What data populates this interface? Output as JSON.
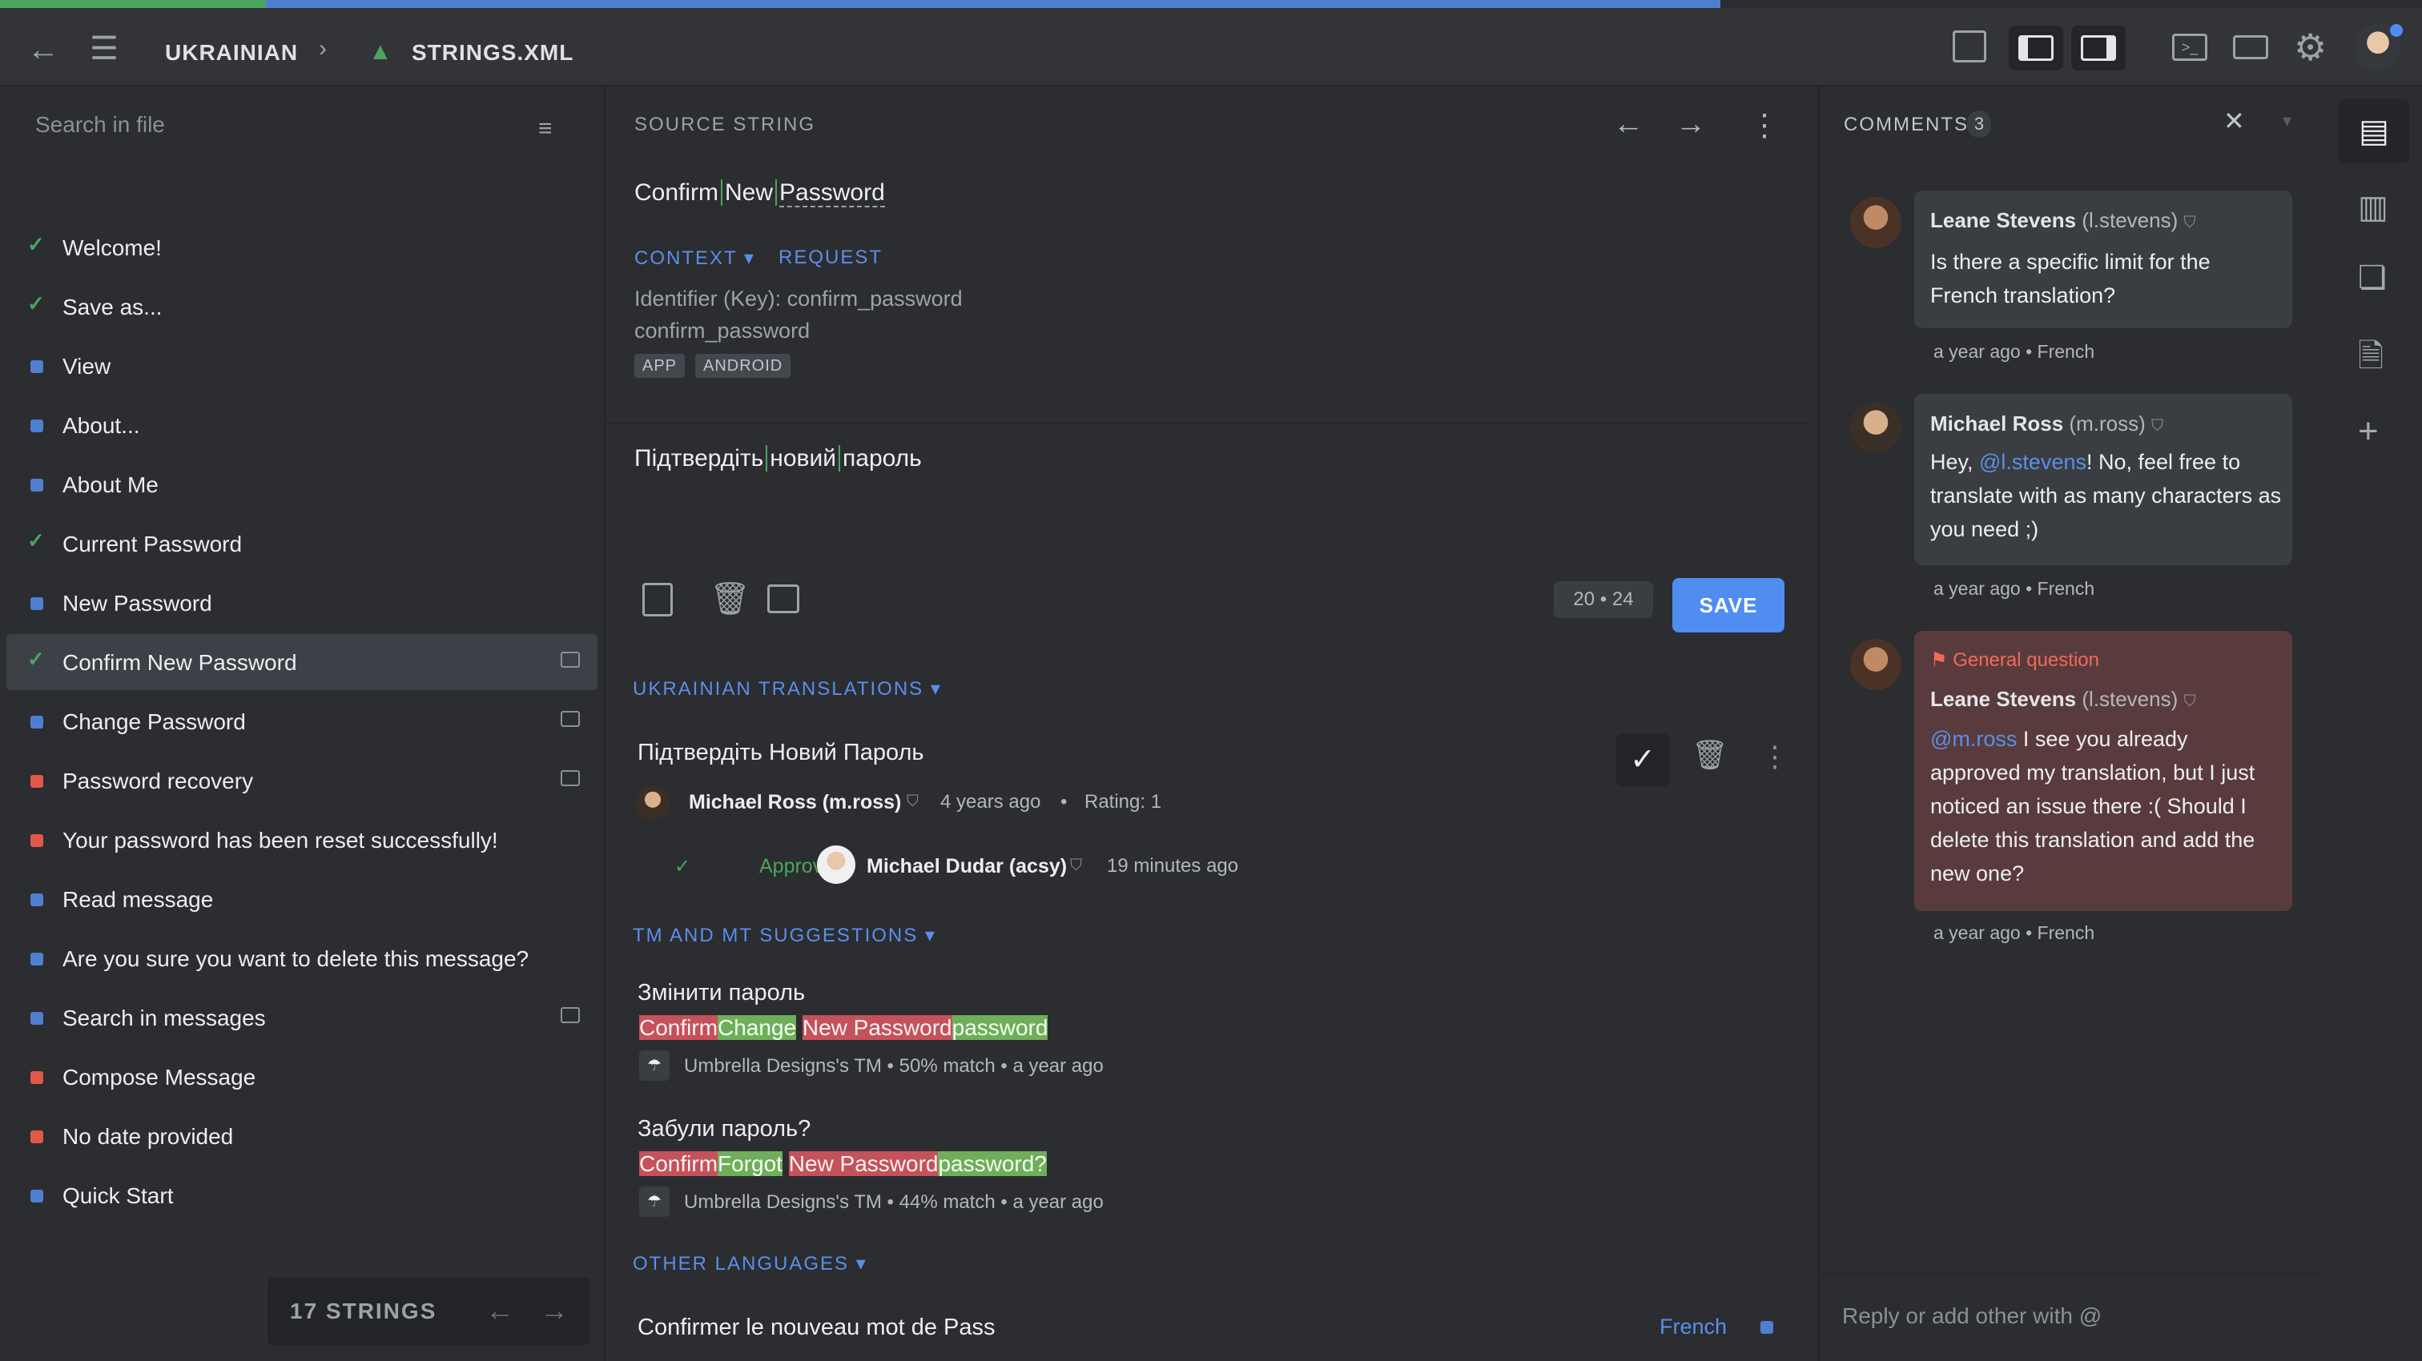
{
  "header": {
    "language": "UKRAINIAN",
    "file": "STRINGS.XML"
  },
  "left_panel": {
    "search_placeholder": "Search in file",
    "strings": [
      {
        "label": "Welcome!",
        "status": "approved"
      },
      {
        "label": "Save as...",
        "status": "approved"
      },
      {
        "label": "View",
        "status": "translated"
      },
      {
        "label": "About...",
        "status": "translated"
      },
      {
        "label": "About Me",
        "status": "translated"
      },
      {
        "label": "Current Password",
        "status": "approved"
      },
      {
        "label": "New Password",
        "status": "translated"
      },
      {
        "label": "Confirm New Password",
        "status": "approved"
      },
      {
        "label": "Change Password",
        "status": "translated"
      },
      {
        "label": "Password recovery",
        "status": "untranslated"
      },
      {
        "label": "Your password has been reset successfully!",
        "status": "untranslated"
      },
      {
        "label": "Read message",
        "status": "translated"
      },
      {
        "label": "Are you sure you want to delete this message?",
        "status": "translated"
      },
      {
        "label": "Search in messages",
        "status": "translated"
      },
      {
        "label": "Compose Message",
        "status": "untranslated"
      },
      {
        "label": "No date provided",
        "status": "untranslated"
      },
      {
        "label": "Quick Start",
        "status": "translated"
      }
    ],
    "footer": "17 STRINGS"
  },
  "source": {
    "label": "SOURCE STRING",
    "text_a": "Confirm",
    "text_b": "New",
    "text_c": "Password",
    "context_label": "CONTEXT",
    "request_label": "REQUEST",
    "identifier": "Identifier (Key): confirm_password",
    "key": "confirm_password",
    "tags": [
      "APP",
      "ANDROID"
    ]
  },
  "editor": {
    "w1": "Підтвердіть",
    "w2": "новий",
    "w3": "пароль",
    "count_a": "20",
    "count_b": "24",
    "save_label": "SAVE"
  },
  "translations": {
    "label": "UKRAINIAN TRANSLATIONS",
    "text": "Підтвердіть Новий Пароль",
    "author": "Michael Ross (m.ross)",
    "time": "4 years ago",
    "rating": "Rating: 1",
    "approved_label": "Approved",
    "approver": "Michael Dudar (acsy)",
    "approved_time": "19 minutes ago"
  },
  "suggestions": {
    "label": "TM AND MT SUGGESTIONS",
    "items": [
      {
        "text": "Змінити пароль",
        "d1": "Confirm",
        "d2": "Change",
        "d3": "New Password",
        "d4": "password",
        "source": "Umbrella Designs's TM",
        "match": "50% match",
        "time": "a year ago"
      },
      {
        "text": "Забули пароль?",
        "d1": "Confirm",
        "d2": "Forgot",
        "d3": "New Password",
        "d4": "password?",
        "source": "Umbrella Designs's TM",
        "match": "44% match",
        "time": "a year ago"
      }
    ]
  },
  "other_languages": {
    "label": "OTHER LANGUAGES",
    "text": "Confirmer le nouveau mot de Pass",
    "language": "French"
  },
  "comments": {
    "label": "COMMENTS",
    "count": "3",
    "reply_placeholder": "Reply or add other with @",
    "items": [
      {
        "name": "Leane Stevens",
        "handle": "(l.stevens)",
        "text": "Is there a specific limit for the French translation?",
        "time": "a year ago",
        "lang": "French"
      },
      {
        "name": "Michael Ross",
        "handle": "(m.ross)",
        "pre": "Hey, ",
        "mention": "@l.stevens",
        "post": "! No, feel free to translate with as many characters as you need ;)",
        "time": "a year ago",
        "lang": "French"
      },
      {
        "issue": "General question",
        "name": "Leane Stevens",
        "handle": "(l.stevens)",
        "mention": "@m.ross",
        "post": " I see you already approved my translation, but I just noticed an issue there :( Should I delete this translation and add the new one?",
        "time": "a year ago",
        "lang": "French"
      }
    ]
  }
}
